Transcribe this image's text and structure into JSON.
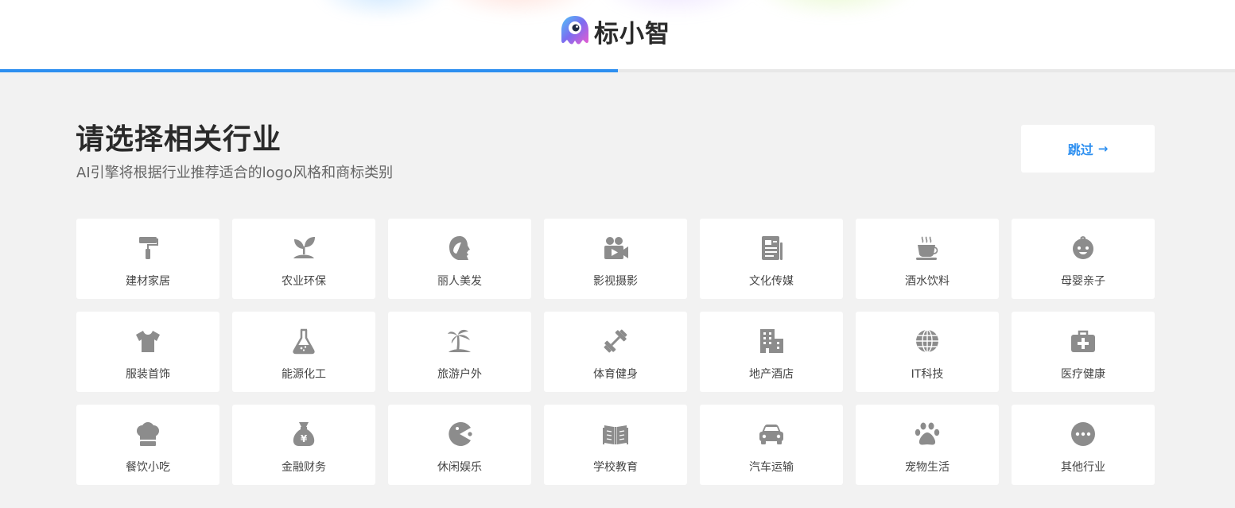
{
  "header": {
    "brand_name": "标小智",
    "progress_fraction": 0.5
  },
  "page": {
    "title": "请选择相关行业",
    "subtitle": "AI引擎将根据行业推荐适合的logo风格和商标类别",
    "skip_label": "跳过"
  },
  "colors": {
    "accent": "#2d8ff0",
    "icon": "#8c8c8c",
    "background": "#f2f2f2",
    "card": "#ffffff"
  },
  "industries": [
    {
      "label": "建材家居",
      "icon": "paint-roller-icon"
    },
    {
      "label": "农业环保",
      "icon": "seedling-icon"
    },
    {
      "label": "丽人美发",
      "icon": "woman-profile-icon"
    },
    {
      "label": "影视摄影",
      "icon": "video-camera-icon"
    },
    {
      "label": "文化传媒",
      "icon": "newspaper-icon"
    },
    {
      "label": "酒水饮料",
      "icon": "hot-cup-icon"
    },
    {
      "label": "母婴亲子",
      "icon": "baby-face-icon"
    },
    {
      "label": "服装首饰",
      "icon": "t-shirt-icon"
    },
    {
      "label": "能源化工",
      "icon": "flask-icon"
    },
    {
      "label": "旅游户外",
      "icon": "palm-island-icon"
    },
    {
      "label": "体育健身",
      "icon": "dumbbell-icon"
    },
    {
      "label": "地产酒店",
      "icon": "building-icon"
    },
    {
      "label": "IT科技",
      "icon": "globe-icon"
    },
    {
      "label": "医疗健康",
      "icon": "medical-kit-icon"
    },
    {
      "label": "餐饮小吃",
      "icon": "chef-hat-icon"
    },
    {
      "label": "金融财务",
      "icon": "money-bag-icon"
    },
    {
      "label": "休闲娱乐",
      "icon": "pacman-icon"
    },
    {
      "label": "学校教育",
      "icon": "open-book-icon"
    },
    {
      "label": "汽车运输",
      "icon": "car-icon"
    },
    {
      "label": "宠物生活",
      "icon": "paw-icon"
    },
    {
      "label": "其他行业",
      "icon": "more-dots-icon"
    }
  ]
}
